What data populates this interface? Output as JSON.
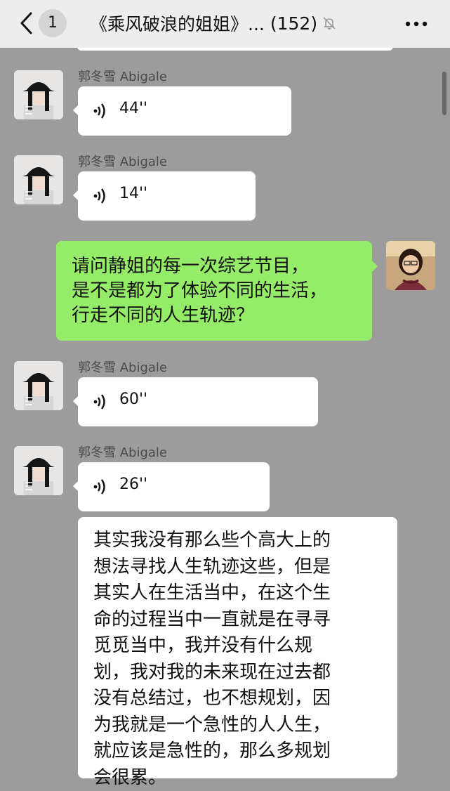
{
  "header": {
    "unread_count": "1",
    "title": "《乘风破浪的姐姐》...",
    "member_count": "(152)",
    "icons": [
      "back-arrow-icon",
      "mute-bell-icon",
      "more-icon"
    ]
  },
  "messages": [
    {
      "sender": "郭冬雪 Abigale",
      "type": "voice",
      "duration": "44''"
    },
    {
      "sender": "郭冬雪 Abigale",
      "type": "voice",
      "duration": "14''"
    },
    {
      "sender": "me",
      "type": "text",
      "lines": [
        "请问静姐的每一次综艺节目，",
        "是不是都为了体验不同的生活，",
        "行走不同的人生轨迹？"
      ]
    },
    {
      "sender": "郭冬雪 Abigale",
      "type": "voice",
      "duration": "60''"
    },
    {
      "sender": "郭冬雪 Abigale",
      "type": "voice",
      "duration": "26''"
    },
    {
      "sender": "郭冬雪 Abigale",
      "type": "text",
      "lines": [
        "其实我没有那么些个高大上的",
        "想法寻找人生轨迹这些，但是",
        "其实人在生活当中，在这个生",
        "命的过程当中一直就是在寻寻",
        "觅觅当中，我并没有什么规",
        "划，我对我的未来现在过去都",
        "没有总结过，也不想规划，因",
        "为我就是一个急性的人人生，",
        "就应该是急性的，那么多规划",
        "会很累。"
      ]
    }
  ],
  "colors": {
    "chat_background": "#9c9c9c",
    "header_background": "#ededed",
    "my_bubble": "#95ec69",
    "other_bubble": "#ffffff"
  }
}
